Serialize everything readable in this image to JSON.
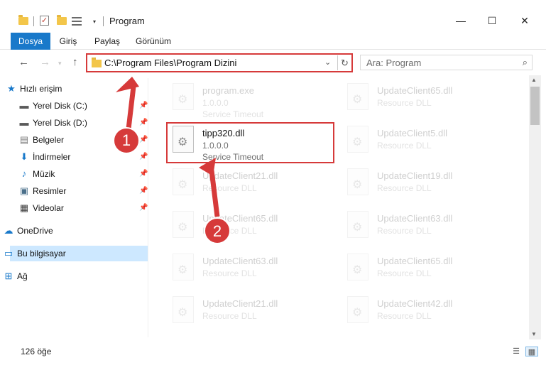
{
  "window": {
    "title": "Program",
    "minimize": "—",
    "maximize": "☐",
    "close": "✕"
  },
  "quick_access_toolbar": {
    "dropdown": "▾"
  },
  "ribbon": {
    "tabs": [
      "Dosya",
      "Giriş",
      "Paylaş",
      "Görünüm"
    ]
  },
  "navigation": {
    "back": "←",
    "forward": "→",
    "up": "↑",
    "address": "C:\\Program Files\\Program Dizini",
    "address_dropdown": "⌄",
    "refresh": "↻",
    "search_placeholder": "Ara: Program",
    "search_icon": "⌕"
  },
  "sidebar": {
    "items": [
      {
        "label": "Hızlı erişim",
        "icon": "star-icon",
        "glyph": "★",
        "color": "#1979ca"
      },
      {
        "label": "Yerel Disk (C:)",
        "icon": "drive-icon",
        "glyph": "▬",
        "color": "#5a5a5a"
      },
      {
        "label": "Yerel Disk (D:)",
        "icon": "drive-icon",
        "glyph": "▬",
        "color": "#5a5a5a"
      },
      {
        "label": "Belgeler",
        "icon": "documents-icon",
        "glyph": "▤",
        "color": "#7a7a7a"
      },
      {
        "label": "İndirmeler",
        "icon": "download-icon",
        "glyph": "⬇",
        "color": "#1979ca"
      },
      {
        "label": "Müzik",
        "icon": "music-icon",
        "glyph": "♪",
        "color": "#1979ca"
      },
      {
        "label": "Resimler",
        "icon": "pictures-icon",
        "glyph": "▣",
        "color": "#4a6f8a"
      },
      {
        "label": "Videolar",
        "icon": "videos-icon",
        "glyph": "▦",
        "color": "#3a3a3a"
      },
      {
        "label": "OneDrive",
        "icon": "cloud-icon",
        "glyph": "☁",
        "color": "#1979ca"
      },
      {
        "label": "Bu bilgisayar",
        "icon": "computer-icon",
        "glyph": "▭",
        "color": "#1979ca"
      },
      {
        "label": "Ağ",
        "icon": "network-icon",
        "glyph": "⊞",
        "color": "#1979ca"
      }
    ],
    "pin_glyph": "📌"
  },
  "files": {
    "left": [
      {
        "name": "program.exe",
        "line2": "1.0.0.0",
        "line3": "Service Timeout"
      },
      {
        "name": "tipp320.dll",
        "line2": "1.0.0.0",
        "line3": "Service Timeout"
      },
      {
        "name": "UpdateClient21.dll",
        "line2": "Resource DLL"
      },
      {
        "name": "UpdateClient65.dll",
        "line2": "Resource DLL"
      },
      {
        "name": "UpdateClient63.dll",
        "line2": "Resource DLL"
      },
      {
        "name": "UpdateClient21.dll",
        "line2": "Resource DLL"
      }
    ],
    "right": [
      {
        "name": "UpdateClient65.dll",
        "line2": "Resource DLL"
      },
      {
        "name": "UpdateClient5.dll",
        "line2": "Resource DLL"
      },
      {
        "name": "UpdateClient19.dll",
        "line2": "Resource DLL"
      },
      {
        "name": "UpdateClient63.dll",
        "line2": "Resource DLL"
      },
      {
        "name": "UpdateClient65.dll",
        "line2": "Resource DLL"
      },
      {
        "name": "UpdateClient42.dll",
        "line2": "Resource DLL"
      }
    ]
  },
  "annotations": {
    "step1": "1",
    "step2": "2",
    "color": "#d63a3a"
  },
  "status": {
    "item_count": "126 öğe",
    "details_view": "☰",
    "large_icons_view": "▦"
  }
}
